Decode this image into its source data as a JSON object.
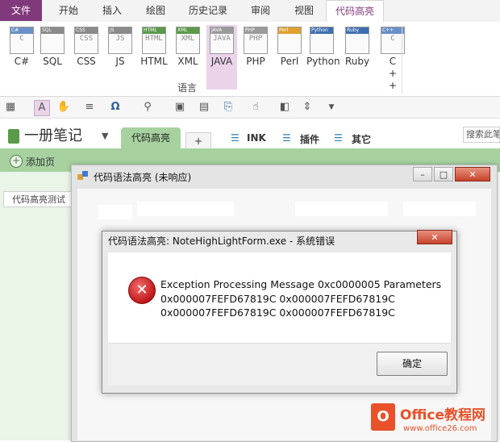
{
  "ribbon": {
    "tabs": [
      "文件",
      "开始",
      "插入",
      "绘图",
      "历史记录",
      "审阅",
      "视图",
      "代码高亮"
    ],
    "active_tab": "代码高亮",
    "languages": [
      {
        "label": "C#",
        "icon": "csharp-file-icon",
        "header": "C#",
        "glyph": "C",
        "color": "#6b8fc9"
      },
      {
        "label": "SQL",
        "icon": "sql-file-icon",
        "header": "SQL",
        "glyph": "",
        "color": "#8a8a8a"
      },
      {
        "label": "CSS",
        "icon": "css-file-icon",
        "header": "CSS",
        "glyph": "CSS",
        "color": "#8a8a8a"
      },
      {
        "label": "JS",
        "icon": "js-file-icon",
        "header": "JS",
        "glyph": "JS",
        "color": "#8a8a8a"
      },
      {
        "label": "HTML",
        "icon": "html-file-icon",
        "header": "HTML",
        "glyph": "HTML",
        "color": "#5a9a4a"
      },
      {
        "label": "XML",
        "icon": "xml-file-icon",
        "header": "XML",
        "glyph": "XML",
        "color": "#5a9a4a"
      },
      {
        "label": "JAVA",
        "icon": "java-file-icon",
        "header": "JAVA",
        "glyph": "JAVA",
        "color": "#9a9a9a"
      },
      {
        "label": "PHP",
        "icon": "php-file-icon",
        "header": "PHP",
        "glyph": "PHP",
        "color": "#9a9a9a"
      },
      {
        "label": "Perl",
        "icon": "perl-file-icon",
        "header": "Perl",
        "glyph": "",
        "color": "#e0a030"
      },
      {
        "label": "Python",
        "icon": "python-file-icon",
        "header": "Python",
        "glyph": "",
        "color": "#3f6fb0"
      },
      {
        "label": "Ruby",
        "icon": "ruby-file-icon",
        "header": "Ruby",
        "glyph": "",
        "color": "#3f6fb0"
      },
      {
        "label": "C++",
        "icon": "cpp-file-icon",
        "header": "C++",
        "glyph": "C",
        "color": "#6b8fc9"
      }
    ],
    "selected_language": "JAVA",
    "group_label": "语言"
  },
  "notebook": {
    "title": "一册笔记",
    "sections": [
      "代码高亮"
    ],
    "add_section": "+",
    "links": [
      "INK",
      "插件",
      "其它"
    ],
    "search_placeholder": "搜索此笔",
    "add_page": "添加页",
    "pages": [
      "代码高亮测试"
    ]
  },
  "app_window": {
    "title": "代码语法高亮 (未响应)"
  },
  "error_dialog": {
    "title": "代码语法高亮: NoteHighLightForm.exe - 系统错误",
    "message_lines": [
      "Exception Processing Message 0xc0000005 Parameters",
      "0x000007FEFD67819C 0x000007FEFD67819C",
      "0x000007FEFD67819C 0x000007FEFD67819C"
    ],
    "ok_label": "确定",
    "close_label": "✕"
  },
  "watermark": {
    "brand": "Office教程网",
    "url": "www.office26.com"
  }
}
